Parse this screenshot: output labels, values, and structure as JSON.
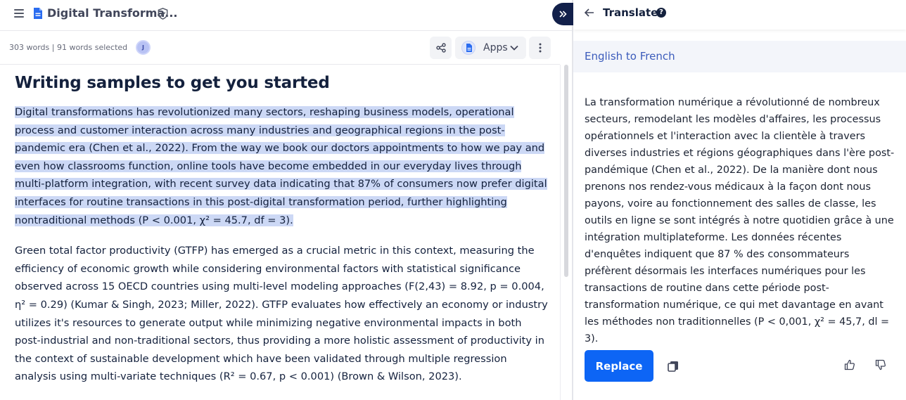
{
  "app": {
    "doc_title": "Digital Transforma...",
    "word_count": "303 words | 91 words selected",
    "avatar_initial": "J",
    "apps_label": "Apps"
  },
  "document": {
    "heading": "Writing samples to get you started",
    "para1_selected": "Digital transformations has revolutionized many sectors, reshaping business models, operational process and customer interaction across many industries and geographical regions in the post-pandemic era (Chen et al., 2022). From the way we book our doctors appointments to how we pay and even how classrooms function, online tools have become embedded in our everyday lives through multi-platform integration, with recent survey data indicating that 87% of consumers now prefer digital interfaces for routine transactions in this post-digital transformation period, further highlighting nontraditional methods (P < 0.001, χ² = 45.7, df = 3).",
    "para2": "Green total factor productivity (GTFP) has emerged as a crucial metric in this context, measuring the efficiency of economic growth while considering environmental factors with statistical significance observed across 15 OECD countries using multi-level modeling approaches (F(2,43) = 8.92, p = 0.004, η² = 0.29) (Kumar & Singh, 2023; Miller, 2022). GTFP evaluates how effectively an economy or industry utilizes it's resources to generate output while minimizing negative environmental impacts in both post-industrial and non-traditional sectors, thus providing a more holistic assessment of productivity in the context of sustainable development which have been validated through multiple regression analysis using multi-variate techniques (R² = 0.67, p < 0.001) (Brown & Wilson, 2023)."
  },
  "panel": {
    "title": "Translate",
    "help": "?",
    "language_pair": "English to French",
    "translation": "La transformation numérique a révolutionné de nombreux secteurs, remodelant les modèles d'affaires, les processus opérationnels et l'interaction avec la clientèle à travers diverses industries et régions géographiques dans l'ère post-pandémique (Chen et al., 2022). De la manière dont nous prenons nos rendez-vous médicaux à la façon dont nous payons, voire au fonctionnement des salles de classe, les outils en ligne se sont intégrés à notre quotidien grâce à une intégration multiplateforme. Les données récentes d'enquêtes indiquent que 87 % des consommateurs préfèrent désormais les interfaces numériques pour les transactions de routine dans cette période post-transformation numérique, ce qui met davantage en avant les méthodes non traditionnelles (P < 0,001, χ² = 45,7, dl = 3).",
    "replace_label": "Replace"
  },
  "colors": {
    "accent": "#0d65f5",
    "selection": "#ccd8f5",
    "heading": "#14213d",
    "lang_bar": "#f3f5fa"
  },
  "icons": [
    "menu-icon",
    "document-icon",
    "shield-icon",
    "share-icon",
    "apps-logo-icon",
    "chevron-down-icon",
    "more-vertical-icon",
    "collapse-panel-icon",
    "back-arrow-icon",
    "help-icon",
    "copy-icon",
    "thumbs-up-icon",
    "thumbs-down-icon"
  ]
}
